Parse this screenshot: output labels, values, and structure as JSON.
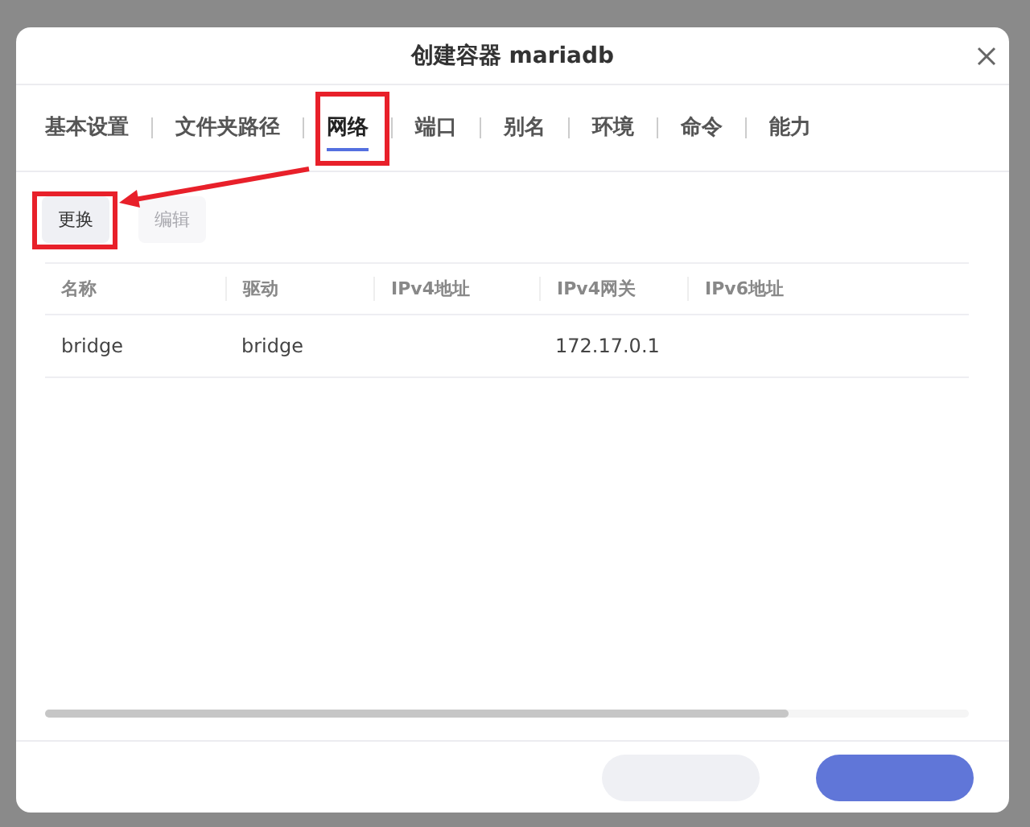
{
  "dialog": {
    "title": "创建容器 mariadb",
    "tabs": [
      {
        "label": "基本设置",
        "selected": false
      },
      {
        "label": "文件夹路径",
        "selected": false
      },
      {
        "label": "网络",
        "selected": true
      },
      {
        "label": "端口",
        "selected": false
      },
      {
        "label": "别名",
        "selected": false
      },
      {
        "label": "环境",
        "selected": false
      },
      {
        "label": "命令",
        "selected": false
      },
      {
        "label": "能力",
        "selected": false
      }
    ],
    "toolbar": [
      {
        "label": "更换",
        "disabled": false
      },
      {
        "label": "编辑",
        "disabled": true
      }
    ],
    "table": {
      "columns": [
        "名称",
        "驱动",
        "IPv4地址",
        "IPv4网关",
        "IPv6地址"
      ],
      "rows": [
        [
          "bridge",
          "bridge",
          "",
          "172.17.0.1",
          ""
        ]
      ]
    }
  }
}
